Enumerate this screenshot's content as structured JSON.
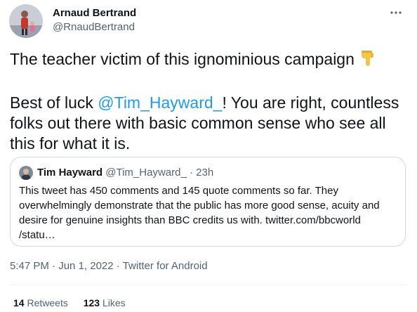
{
  "author": {
    "name": "Arnaud Bertrand",
    "handle": "@RnaudBertrand"
  },
  "tweet": {
    "line1": "The teacher victim of this ignominious campaign",
    "emoji_icon": "point-down-icon",
    "p2_prefix": "Best of luck ",
    "mention": "@Tim_Hayward_",
    "p2_suffix": "! You are right, countless folks out there with basic common sense who see all this for what it is."
  },
  "quote": {
    "name": "Tim Hayward",
    "handle": "@Tim_Hayward_",
    "sep": "·",
    "time": "23h",
    "text": "This tweet has 450 comments and 145 quote comments so far. They overwhelmingly demonstrate that the public has more good sense, acuity and desire for genuine insights than BBC credits us with. twitter.com/bbcworld /statu…"
  },
  "meta": {
    "time": "5:47 PM",
    "sep1": "·",
    "date": "Jun 1, 2022",
    "sep2": "·",
    "source": "Twitter for Android"
  },
  "stats": {
    "retweets_count": "14",
    "retweets_label": "Retweets",
    "likes_count": "123",
    "likes_label": "Likes"
  },
  "colors": {
    "accent": "#1d9bf0",
    "secondary_text": "#536471",
    "border": "#cfd9de"
  },
  "icons": [
    "more-icon",
    "point-down-icon"
  ]
}
